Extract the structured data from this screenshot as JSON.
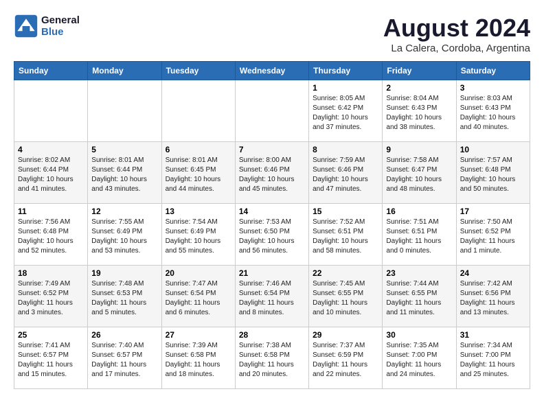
{
  "header": {
    "logo_line1": "General",
    "logo_line2": "Blue",
    "main_title": "August 2024",
    "subtitle": "La Calera, Cordoba, Argentina"
  },
  "weekdays": [
    "Sunday",
    "Monday",
    "Tuesday",
    "Wednesday",
    "Thursday",
    "Friday",
    "Saturday"
  ],
  "weeks": [
    [
      {
        "day": "",
        "info": ""
      },
      {
        "day": "",
        "info": ""
      },
      {
        "day": "",
        "info": ""
      },
      {
        "day": "",
        "info": ""
      },
      {
        "day": "1",
        "info": "Sunrise: 8:05 AM\nSunset: 6:42 PM\nDaylight: 10 hours\nand 37 minutes."
      },
      {
        "day": "2",
        "info": "Sunrise: 8:04 AM\nSunset: 6:43 PM\nDaylight: 10 hours\nand 38 minutes."
      },
      {
        "day": "3",
        "info": "Sunrise: 8:03 AM\nSunset: 6:43 PM\nDaylight: 10 hours\nand 40 minutes."
      }
    ],
    [
      {
        "day": "4",
        "info": "Sunrise: 8:02 AM\nSunset: 6:44 PM\nDaylight: 10 hours\nand 41 minutes."
      },
      {
        "day": "5",
        "info": "Sunrise: 8:01 AM\nSunset: 6:44 PM\nDaylight: 10 hours\nand 43 minutes."
      },
      {
        "day": "6",
        "info": "Sunrise: 8:01 AM\nSunset: 6:45 PM\nDaylight: 10 hours\nand 44 minutes."
      },
      {
        "day": "7",
        "info": "Sunrise: 8:00 AM\nSunset: 6:46 PM\nDaylight: 10 hours\nand 45 minutes."
      },
      {
        "day": "8",
        "info": "Sunrise: 7:59 AM\nSunset: 6:46 PM\nDaylight: 10 hours\nand 47 minutes."
      },
      {
        "day": "9",
        "info": "Sunrise: 7:58 AM\nSunset: 6:47 PM\nDaylight: 10 hours\nand 48 minutes."
      },
      {
        "day": "10",
        "info": "Sunrise: 7:57 AM\nSunset: 6:48 PM\nDaylight: 10 hours\nand 50 minutes."
      }
    ],
    [
      {
        "day": "11",
        "info": "Sunrise: 7:56 AM\nSunset: 6:48 PM\nDaylight: 10 hours\nand 52 minutes."
      },
      {
        "day": "12",
        "info": "Sunrise: 7:55 AM\nSunset: 6:49 PM\nDaylight: 10 hours\nand 53 minutes."
      },
      {
        "day": "13",
        "info": "Sunrise: 7:54 AM\nSunset: 6:49 PM\nDaylight: 10 hours\nand 55 minutes."
      },
      {
        "day": "14",
        "info": "Sunrise: 7:53 AM\nSunset: 6:50 PM\nDaylight: 10 hours\nand 56 minutes."
      },
      {
        "day": "15",
        "info": "Sunrise: 7:52 AM\nSunset: 6:51 PM\nDaylight: 10 hours\nand 58 minutes."
      },
      {
        "day": "16",
        "info": "Sunrise: 7:51 AM\nSunset: 6:51 PM\nDaylight: 11 hours\nand 0 minutes."
      },
      {
        "day": "17",
        "info": "Sunrise: 7:50 AM\nSunset: 6:52 PM\nDaylight: 11 hours\nand 1 minute."
      }
    ],
    [
      {
        "day": "18",
        "info": "Sunrise: 7:49 AM\nSunset: 6:52 PM\nDaylight: 11 hours\nand 3 minutes."
      },
      {
        "day": "19",
        "info": "Sunrise: 7:48 AM\nSunset: 6:53 PM\nDaylight: 11 hours\nand 5 minutes."
      },
      {
        "day": "20",
        "info": "Sunrise: 7:47 AM\nSunset: 6:54 PM\nDaylight: 11 hours\nand 6 minutes."
      },
      {
        "day": "21",
        "info": "Sunrise: 7:46 AM\nSunset: 6:54 PM\nDaylight: 11 hours\nand 8 minutes."
      },
      {
        "day": "22",
        "info": "Sunrise: 7:45 AM\nSunset: 6:55 PM\nDaylight: 11 hours\nand 10 minutes."
      },
      {
        "day": "23",
        "info": "Sunrise: 7:44 AM\nSunset: 6:55 PM\nDaylight: 11 hours\nand 11 minutes."
      },
      {
        "day": "24",
        "info": "Sunrise: 7:42 AM\nSunset: 6:56 PM\nDaylight: 11 hours\nand 13 minutes."
      }
    ],
    [
      {
        "day": "25",
        "info": "Sunrise: 7:41 AM\nSunset: 6:57 PM\nDaylight: 11 hours\nand 15 minutes."
      },
      {
        "day": "26",
        "info": "Sunrise: 7:40 AM\nSunset: 6:57 PM\nDaylight: 11 hours\nand 17 minutes."
      },
      {
        "day": "27",
        "info": "Sunrise: 7:39 AM\nSunset: 6:58 PM\nDaylight: 11 hours\nand 18 minutes."
      },
      {
        "day": "28",
        "info": "Sunrise: 7:38 AM\nSunset: 6:58 PM\nDaylight: 11 hours\nand 20 minutes."
      },
      {
        "day": "29",
        "info": "Sunrise: 7:37 AM\nSunset: 6:59 PM\nDaylight: 11 hours\nand 22 minutes."
      },
      {
        "day": "30",
        "info": "Sunrise: 7:35 AM\nSunset: 7:00 PM\nDaylight: 11 hours\nand 24 minutes."
      },
      {
        "day": "31",
        "info": "Sunrise: 7:34 AM\nSunset: 7:00 PM\nDaylight: 11 hours\nand 25 minutes."
      }
    ]
  ]
}
